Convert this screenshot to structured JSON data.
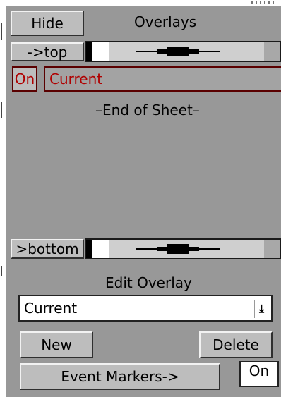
{
  "header": {
    "hide_label": "Hide",
    "title": "Overlays"
  },
  "overlay_list": {
    "to_top_label": "->top",
    "to_bottom_label": ">bottom",
    "rows": [
      {
        "visibility": "On",
        "name": "Current"
      }
    ],
    "end_label": "–End of Sheet–"
  },
  "edit": {
    "title": "Edit Overlay",
    "selected": "Current",
    "dropdown_icon": "down-arrow-underline-icon",
    "new_label": "New",
    "delete_label": "Delete",
    "event_markers_label": "Event Markers->",
    "event_markers_state": "On"
  },
  "colors": {
    "panel": "#989898",
    "button": "#bdbdbd",
    "accent_text": "#b00000"
  }
}
